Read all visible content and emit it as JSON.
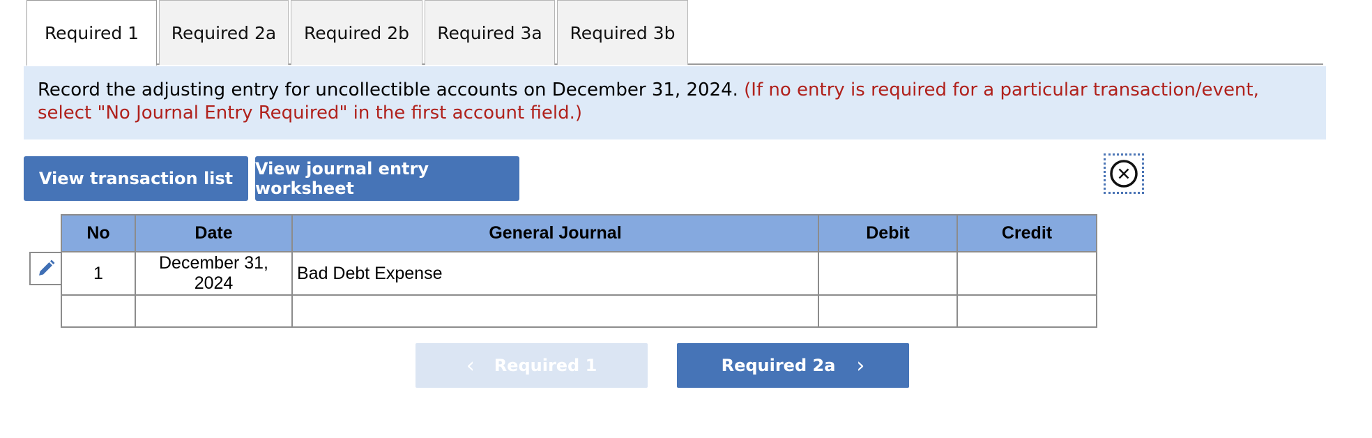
{
  "tabs": [
    {
      "label": "Required 1",
      "active": true
    },
    {
      "label": "Required 2a",
      "active": false
    },
    {
      "label": "Required 2b",
      "active": false
    },
    {
      "label": "Required 3a",
      "active": false
    },
    {
      "label": "Required 3b",
      "active": false
    }
  ],
  "instruction": {
    "text": "Record the adjusting entry for uncollectible accounts on December 31, 2024.",
    "note": "(If no entry is required for a particular transaction/event, select \"No Journal Entry Required\" in the first account field.)"
  },
  "buttons": {
    "view_transaction_list": "View transaction list",
    "view_journal_worksheet": "View journal entry worksheet"
  },
  "close_icon": "close-circle-icon",
  "edit_icon": "pencil-icon",
  "table": {
    "headers": {
      "no": "No",
      "date": "Date",
      "journal": "General Journal",
      "debit": "Debit",
      "credit": "Credit"
    },
    "rows": [
      {
        "no": "1",
        "date_line1": "December 31,",
        "date_line2": "2024",
        "account": "Bad Debt Expense",
        "debit": "",
        "credit": ""
      },
      {
        "no": "",
        "date_line1": "",
        "date_line2": "",
        "account": "",
        "debit": "",
        "credit": ""
      }
    ]
  },
  "nav": {
    "prev_label": "Required 1",
    "next_label": "Required 2a",
    "prev_enabled": false
  },
  "colors": {
    "primary_button": "#4674b7",
    "header_fill": "#85a9df",
    "instruction_bg": "#deeaf8",
    "note_text": "#b0211c"
  }
}
